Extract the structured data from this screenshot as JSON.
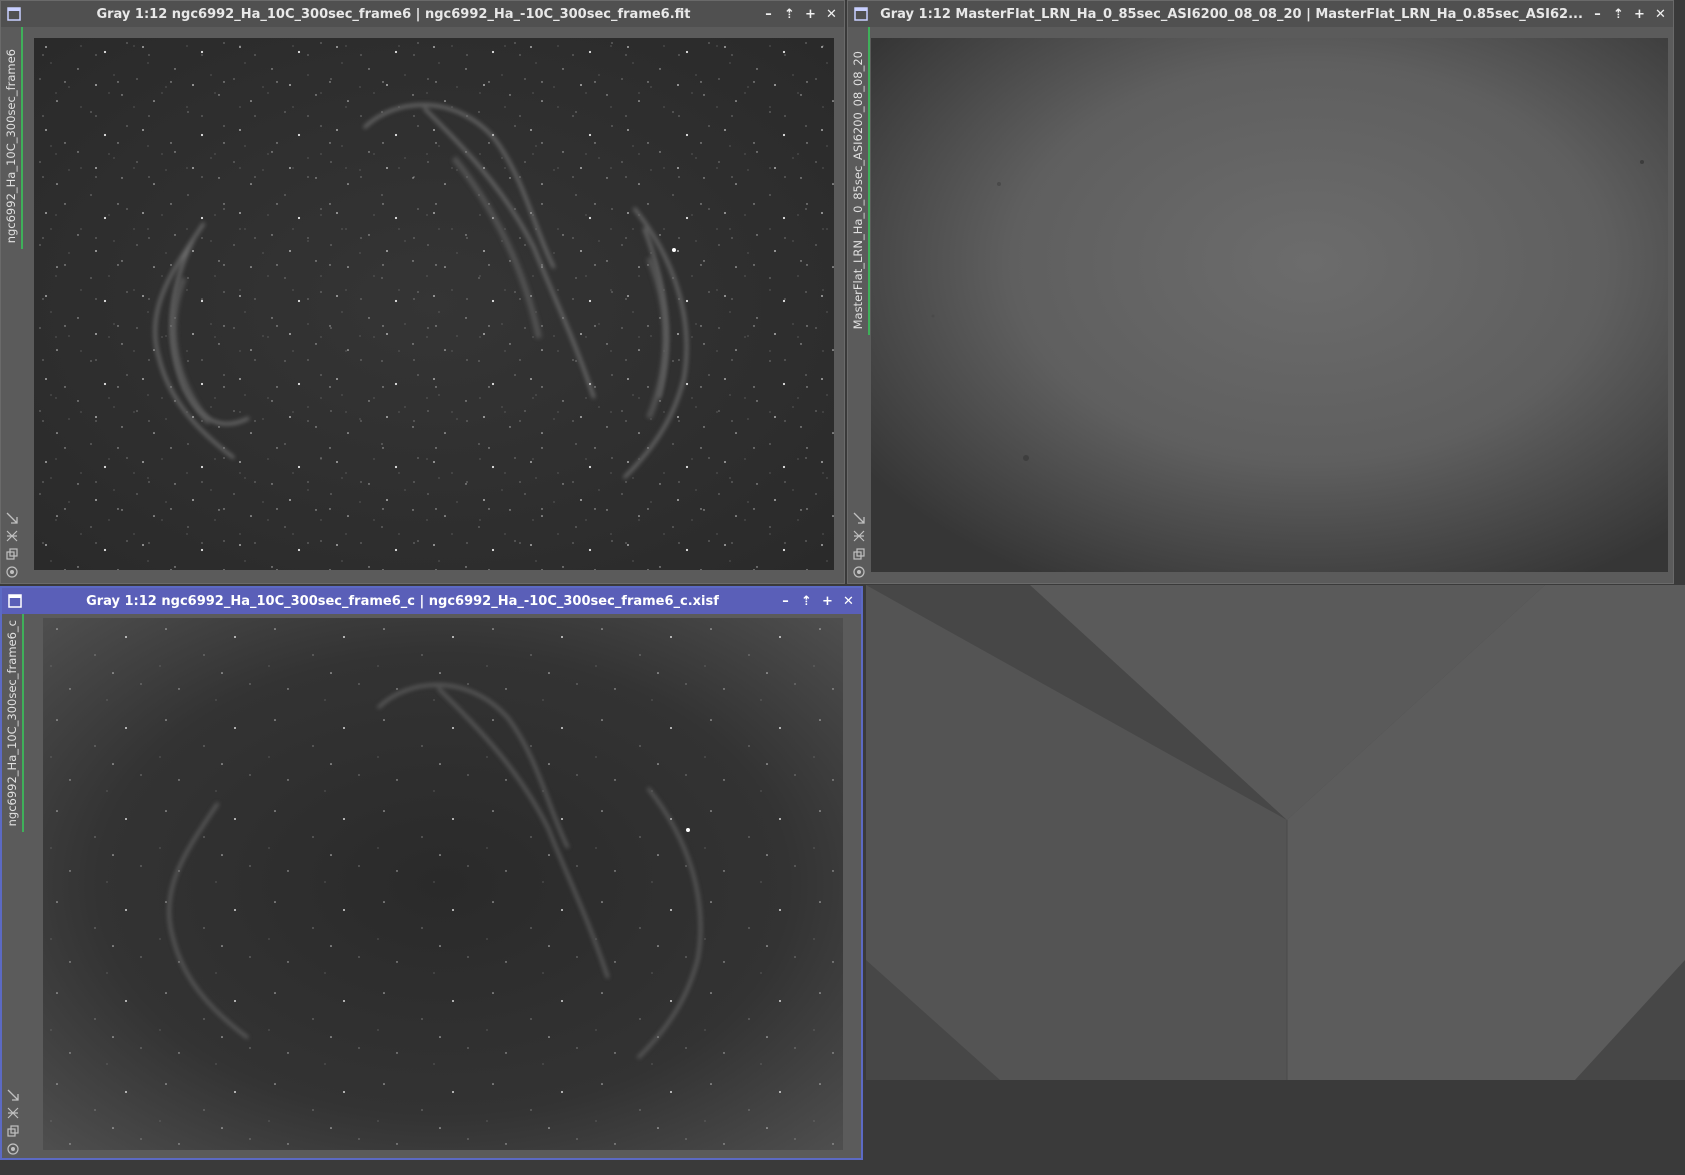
{
  "workspace": {
    "background_color": "#3a3a3a"
  },
  "windows": [
    {
      "id": "frame6",
      "title": "Gray 1:12 ngc6992_Ha_10C_300sec_frame6 | ngc6992_Ha_-10C_300sec_frame6.fit",
      "tab_label": "ngc6992_Ha_10C_300sec_frame6",
      "active": false
    },
    {
      "id": "masterflat",
      "title": "Gray 1:12 MasterFlat_LRN_Ha_0_85sec_ASI6200_08_08_20 | MasterFlat_LRN_Ha_0.85sec_ASI62...",
      "tab_label": "MasterFlat_LRN_Ha_0_85sec_ASI6200_08_08_20",
      "active": false
    },
    {
      "id": "frame6c",
      "title": "Gray 1:12 ngc6992_Ha_10C_300sec_frame6_c | ngc6992_Ha_-10C_300sec_frame6_c.xisf",
      "tab_label": "ngc6992_Ha_10C_300sec_frame6_c",
      "active": true
    }
  ],
  "title_buttons": {
    "minimize": "–",
    "shade": "⇡",
    "maximize": "+",
    "close": "✕"
  },
  "side_tool_icons": [
    "fit-view-icon",
    "zoom-icon",
    "clone-icon",
    "stf-icon"
  ],
  "accent_colors": {
    "active_title": "#5a5fb8",
    "active_border": "#5c6ac4",
    "tab_marker": "#3fb05a"
  }
}
